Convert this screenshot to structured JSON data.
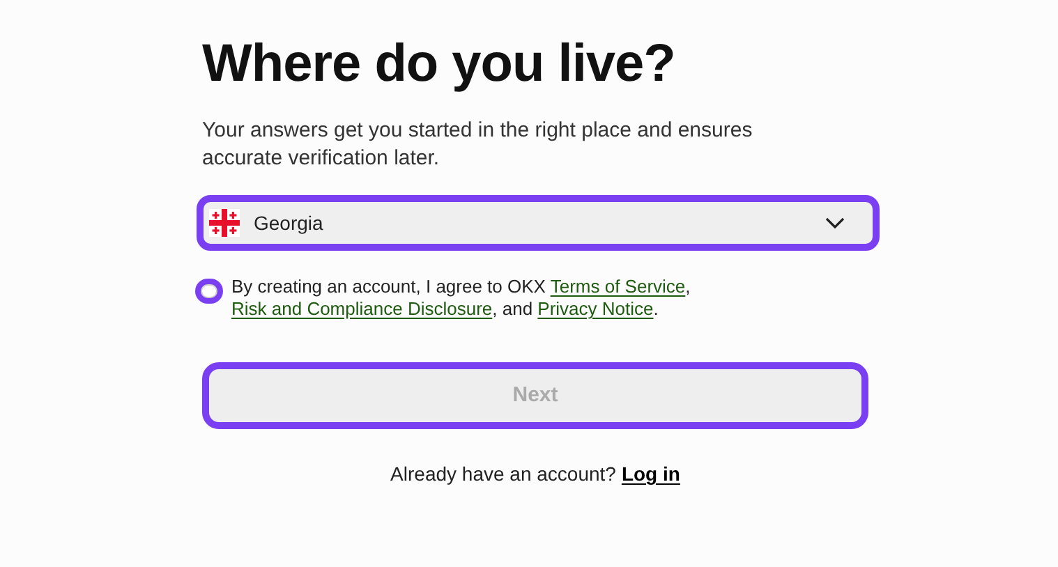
{
  "title": "Where do you live?",
  "subtitle": "Your answers get you started in the right place and ensures accurate verification later.",
  "country_select": {
    "value": "Georgia"
  },
  "agreement": {
    "checked": false,
    "parts": [
      {
        "kind": "text",
        "text": "By creating an account, I agree to OKX "
      },
      {
        "kind": "link",
        "text": "Terms of Service"
      },
      {
        "kind": "text",
        "text": ", "
      },
      {
        "kind": "link",
        "text": "Risk and Compliance Disclosure"
      },
      {
        "kind": "text",
        "text": ", and "
      },
      {
        "kind": "link",
        "text": "Privacy Notice"
      },
      {
        "kind": "text",
        "text": "."
      }
    ]
  },
  "next_button": {
    "label": "Next",
    "disabled": true
  },
  "login_prompt": {
    "text": "Already have an account?",
    "link": "Log in"
  }
}
